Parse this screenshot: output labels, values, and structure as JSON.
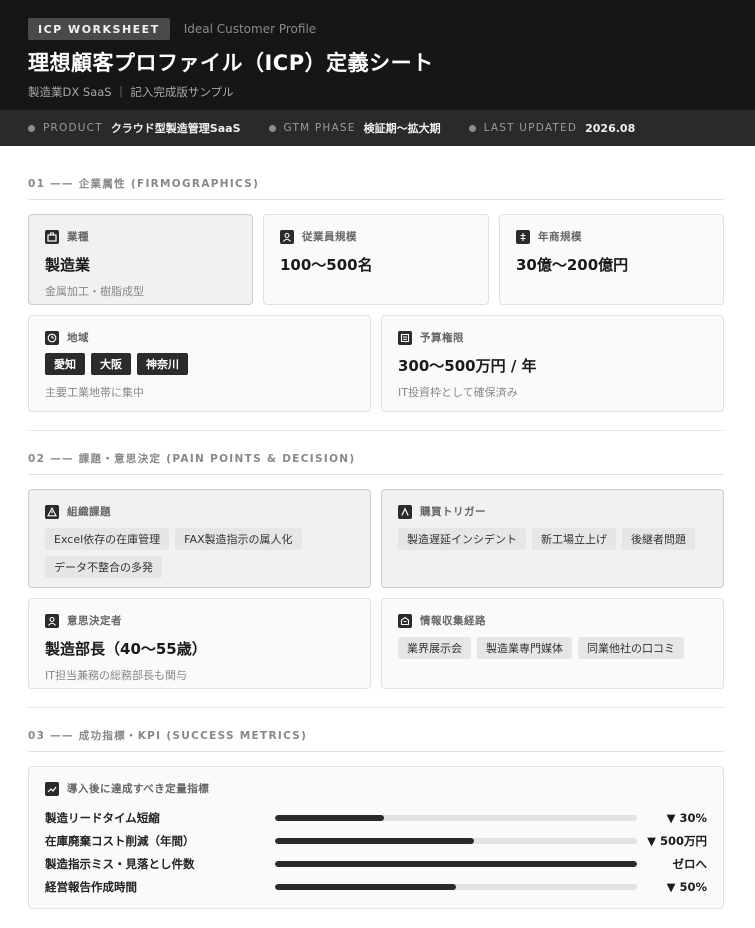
{
  "header": {
    "badge": "ICP WORKSHEET",
    "badge_sub": "Ideal Customer Profile",
    "title": "理想顧客プロファイル（ICP）定義シート",
    "subtitle": "製造業DX SaaS ｜ 記入完成版サンプル"
  },
  "meta": [
    {
      "label": "PRODUCT",
      "value": "クラウド型製造管理SaaS"
    },
    {
      "label": "GTM PHASE",
      "value": "検証期〜拡大期"
    },
    {
      "label": "LAST UPDATED",
      "value": "2026.08"
    }
  ],
  "section1": {
    "title": "01 —— 企業属性 (FIRMOGRAPHICS)",
    "industry": {
      "label": "業種",
      "icon": "briefcase-icon",
      "value": "製造業",
      "note": "金属加工・樹脂成型"
    },
    "employees": {
      "label": "従業員規模",
      "icon": "person-icon",
      "value": "100〜500名"
    },
    "revenue": {
      "label": "年商規模",
      "icon": "yen-icon",
      "value": "30億〜200億円"
    },
    "region": {
      "label": "地域",
      "icon": "clock-icon",
      "tags": [
        "愛知",
        "大阪",
        "神奈川"
      ],
      "note": "主要工業地帯に集中"
    },
    "budget": {
      "label": "予算権限",
      "icon": "calculator-icon",
      "value": "300〜500万円 / 年",
      "note": "IT投資枠として確保済み"
    }
  },
  "section2": {
    "title": "02 —— 課題・意思決定 (PAIN POINTS & DECISION)",
    "issues": {
      "label": "組織課題",
      "icon": "warning-icon",
      "tags": [
        "Excel依存の在庫管理",
        "FAX製造指示の属人化",
        "データ不整合の多発"
      ]
    },
    "triggers": {
      "label": "購買トリガー",
      "icon": "trigger-icon",
      "tags": [
        "製造遅延インシデント",
        "新工場立上げ",
        "後継者問題"
      ]
    },
    "decision": {
      "label": "意思決定者",
      "icon": "person-icon",
      "value": "製造部長（40〜55歳）",
      "note": "IT担当兼務の総務部長も関与"
    },
    "channels": {
      "label": "情報収集経路",
      "icon": "info-icon",
      "tags": [
        "業界展示会",
        "製造業専門媒体",
        "同業他社の口コミ"
      ]
    }
  },
  "section3": {
    "title": "03 —— 成功指標・KPI (SUCCESS METRICS)",
    "card_label": "導入後に達成すべき定量指標",
    "icon": "trend-icon",
    "kpis": [
      {
        "name": "製造リードタイム短縮",
        "progress": 0.3,
        "value": "▼ 30%"
      },
      {
        "name": "在庫廃棄コスト削減（年間）",
        "progress": 0.55,
        "value": "▼ 500万円"
      },
      {
        "name": "製造指示ミス・見落とし件数",
        "progress": 1.0,
        "value": "ゼロへ"
      },
      {
        "name": "経営報告作成時間",
        "progress": 0.5,
        "value": "▼ 50%"
      }
    ]
  }
}
